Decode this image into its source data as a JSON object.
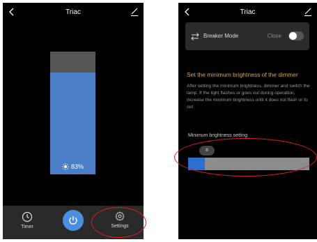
{
  "left_screen": {
    "title": "Triac",
    "brightness_percent": 83,
    "brightness_readout": "83%",
    "bottom_bar": {
      "timer_label": "Timer",
      "settings_label": "Settings"
    }
  },
  "right_screen": {
    "title": "Triac",
    "breaker": {
      "label": "Breaker Mode",
      "state_label": "Close",
      "toggle_on": false
    },
    "min_brightness": {
      "title": "Set the minimum brightness of the dimmer",
      "description": "After setting the minimum brightness, dimmer and switch the lamp. If the light flashes or goes out during operation, increase the minimum brightness until it does not flash or to out",
      "setting_label": "Minimum brightness setting",
      "value": "8",
      "value_percent": 8
    }
  },
  "colors": {
    "accent_blue": "#4a7fc7",
    "power_blue": "#4a8ee0",
    "title_gold": "#d9a53a",
    "annotation_red": "#e1201c"
  }
}
